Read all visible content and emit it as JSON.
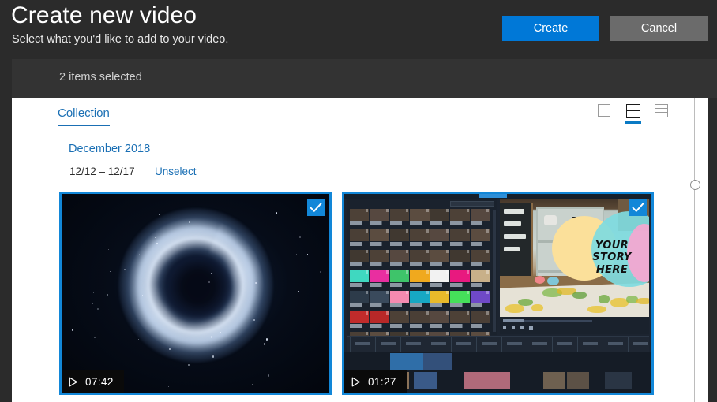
{
  "window": {
    "title": "Create new video",
    "subtitle": "Select what you'd like to add to your video."
  },
  "header_buttons": {
    "create_label": "Create",
    "cancel_label": "Cancel",
    "create_color": "#0078d7",
    "cancel_color": "#6b6b6b"
  },
  "selection_bar": {
    "label": "2 items selected",
    "count": 2
  },
  "tabs": [
    {
      "label": "Collection",
      "selected": true
    }
  ],
  "view_modes": [
    {
      "name": "large-view",
      "icon": "single-square-icon",
      "selected": false
    },
    {
      "name": "medium-view",
      "icon": "grid-2x2-icon",
      "selected": true
    },
    {
      "name": "small-view",
      "icon": "grid-3x3-icon",
      "selected": false
    }
  ],
  "groups": [
    {
      "title": "December 2018",
      "date_range": "12/12 – 12/17",
      "unselect_label": "Unselect"
    }
  ],
  "items": [
    {
      "name": "nebula-video",
      "duration": "07:42",
      "selected": true,
      "play_icon": "play-outline-icon",
      "check_icon": "checkmark-icon"
    },
    {
      "name": "video-editor-tutorial",
      "duration": "01:27",
      "selected": true,
      "play_icon": "play-outline-icon",
      "check_icon": "checkmark-icon",
      "overlay_text_lines": [
        "YOUR",
        "STORY",
        "HERE"
      ]
    }
  ],
  "scrollbar": {
    "orientation": "vertical",
    "handle_position_percent": 30
  },
  "colors": {
    "accent": "#0078d7",
    "link": "#1a6fb4",
    "selection_border": "#1287d8",
    "chrome_dark": "#2b2b2b",
    "strip_dark": "#333333",
    "panel": "#ffffff"
  }
}
